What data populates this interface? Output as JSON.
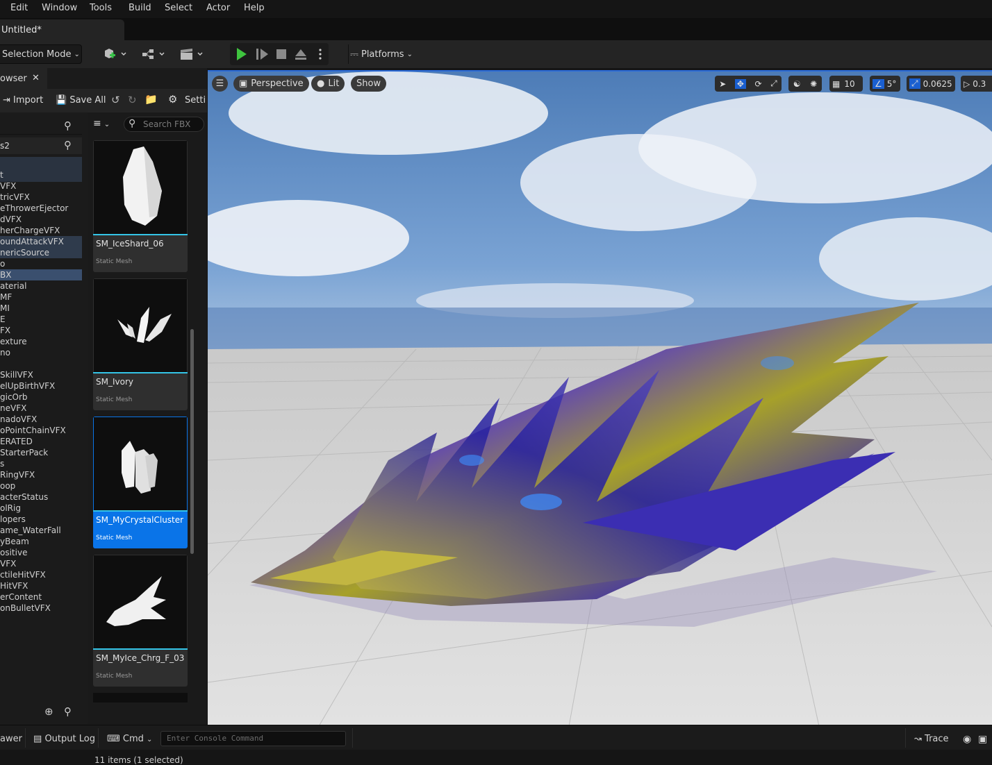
{
  "menu": [
    "Edit",
    "Window",
    "Tools",
    "Build",
    "Select",
    "Actor",
    "Help"
  ],
  "document_tab": "Untitled*",
  "toolbar": {
    "selection_mode": "Selection Mode",
    "platforms": "Platforms"
  },
  "content_browser": {
    "tab_label": "owser",
    "import_label": "Import",
    "save_all_label": "Save All",
    "settings_label": "Setti",
    "filter_title": "s2",
    "search_placeholder": "Search FBX",
    "tree_items": [
      "t",
      "VFX",
      "tricVFX",
      "eThrowerEjector",
      "dVFX",
      "herChargeVFX",
      "oundAttackVFX",
      "nericSource",
      "o",
      "BX",
      "aterial",
      "MF",
      "MI",
      "E",
      "FX",
      "exture",
      "no",
      "",
      "SkillVFX",
      "elUpBirthVFX",
      "gicOrb",
      "neVFX",
      "nadoVFX",
      "oPointChainVFX",
      "ERATED",
      "StarterPack",
      "s",
      "RingVFX",
      "oop",
      "acterStatus",
      "olRig",
      "lopers",
      "ame_WaterFall",
      "yBeam",
      "ositive",
      "VFX",
      "ctileHitVFX",
      "HitVFX",
      "erContent",
      "onBulletVFX"
    ],
    "assets": [
      {
        "name": "SM_IceShard_06",
        "type": "Static Mesh"
      },
      {
        "name": "SM_Ivory",
        "type": "Static Mesh"
      },
      {
        "name": "SM_MyCrystalCluster",
        "type": "Static Mesh"
      },
      {
        "name": "SM_MyIce_Chrg_F_03",
        "type": "Static Mesh"
      }
    ],
    "status": "11 items (1 selected)"
  },
  "viewport": {
    "perspective": "Perspective",
    "lit": "Lit",
    "show": "Show",
    "grid_size": "10",
    "angle_snap": "5°",
    "scale_snap": "0.0625",
    "camera_speed": "0.3"
  },
  "bottom": {
    "drawer": "awer",
    "output_log": "Output Log",
    "cmd": "Cmd",
    "console_placeholder": "Enter Console Command",
    "trace": "Trace"
  }
}
